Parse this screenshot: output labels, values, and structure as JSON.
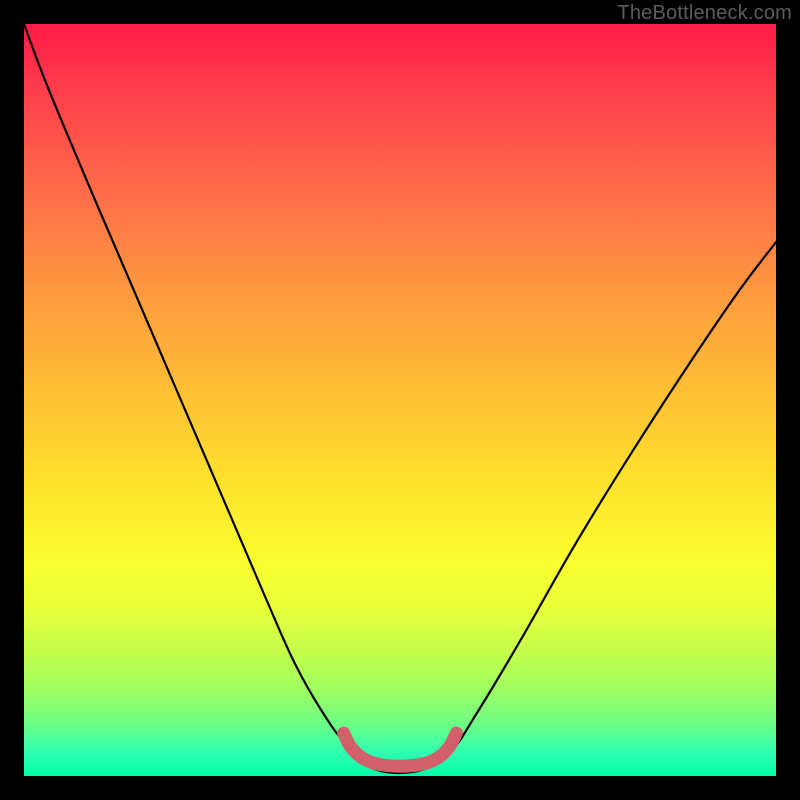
{
  "watermark": "TheBottleneck.com",
  "colors": {
    "frame": "#000000",
    "curve_stroke": "#000000",
    "bumper_stroke": "#d1606a",
    "bumper_fill": "none",
    "gradient_top": "#ff1a47",
    "gradient_bottom": "#00ffa8"
  },
  "chart_data": {
    "type": "line",
    "title": "",
    "xlabel": "",
    "ylabel": "",
    "xlim": [
      0,
      100
    ],
    "ylim": [
      0,
      100
    ],
    "notes": "No axes, ticks, or legend rendered. Values are approximate, estimated from pixel positions; x is horizontal % across plot, y is vertical % from top of plot. Lower y = higher on image.",
    "series": [
      {
        "name": "main-curve",
        "color": "#000000",
        "x": [
          0,
          3,
          8,
          14,
          20,
          26,
          32,
          36,
          40,
          43,
          46,
          50,
          54,
          57,
          60,
          66,
          74,
          84,
          94,
          100
        ],
        "y": [
          0,
          8,
          20,
          34,
          48,
          62,
          76,
          85,
          92,
          96,
          98.8,
          99.6,
          98.8,
          96.5,
          92,
          82,
          68,
          52,
          37,
          29
        ]
      },
      {
        "name": "bottom-bumper",
        "color": "#d1606a",
        "x": [
          42.5,
          43.5,
          45,
          47,
          50,
          53,
          55,
          56.5,
          57.5
        ],
        "y": [
          94.3,
          96.2,
          97.6,
          98.4,
          98.7,
          98.4,
          97.6,
          96.2,
          94.3
        ]
      }
    ]
  }
}
